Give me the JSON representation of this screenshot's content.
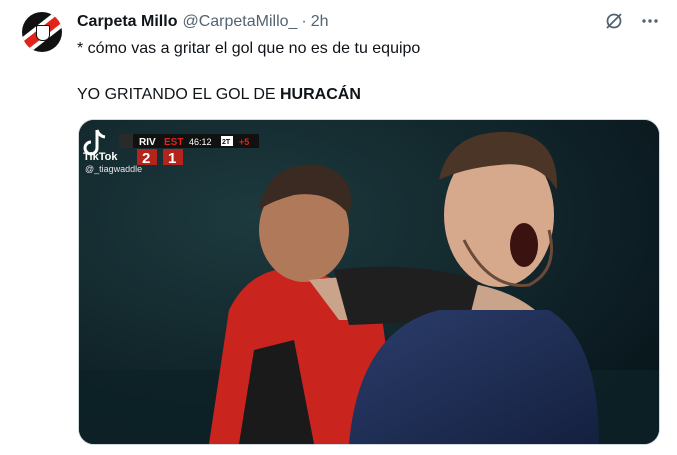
{
  "tweet": {
    "display_name": "Carpeta Millo",
    "handle": "@CarpetaMillo_",
    "separator": "·",
    "time": "2h",
    "line1": "* cómo vas a gritar el gol que no es de tu equipo",
    "line2_prefix": "YO GRITANDO EL GOL DE ",
    "line2_bold": "HURACÁN"
  },
  "icons": {
    "grok": "grok-icon",
    "more": "more-icon"
  },
  "scoreboard": {
    "home": "RIV",
    "away": "EST",
    "home_score": "2",
    "away_score": "1",
    "clock": "46:12",
    "period": "2T",
    "added": "+5"
  },
  "watermark": {
    "app": "TikTok",
    "user": "@_tiagwaddle"
  },
  "colors": {
    "text": "#0f1419",
    "secondary": "#536471",
    "river_red": "#e2231a"
  }
}
